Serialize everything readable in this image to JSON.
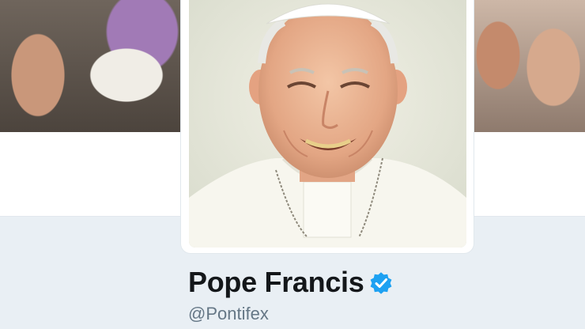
{
  "profile": {
    "name": "Pope Francis",
    "screen_name": "@Pontifex",
    "verified": true
  },
  "icons": {
    "verified_badge": "verified-badge-icon"
  },
  "colors": {
    "background": "#e9eff4",
    "card": "#ffffff",
    "name_text": "#14171a",
    "screen_name_text": "#657786",
    "verified_blue": "#1da1f2"
  }
}
